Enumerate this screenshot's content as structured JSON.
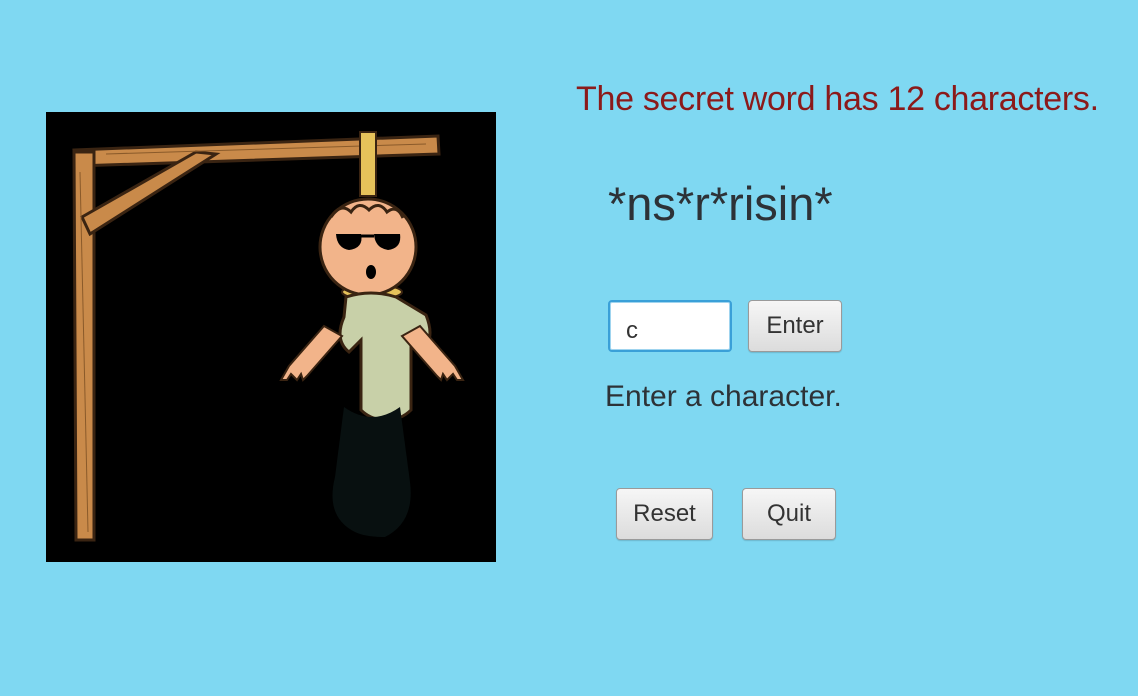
{
  "game": {
    "message": "The secret word has 12 characters.",
    "masked_word": "*ns*r*risin*",
    "guess_value": "c",
    "prompt": "Enter a character.",
    "hangman_stage": "full-body"
  },
  "buttons": {
    "enter": "Enter",
    "reset": "Reset",
    "quit": "Quit"
  },
  "colors": {
    "background": "#7fd8f2",
    "message": "#8b1a1a",
    "text": "#2d3237",
    "gallows": "#c98a4a",
    "rope": "#e6c25a",
    "skin": "#f2b48a",
    "shirt": "#c8d0a8"
  }
}
